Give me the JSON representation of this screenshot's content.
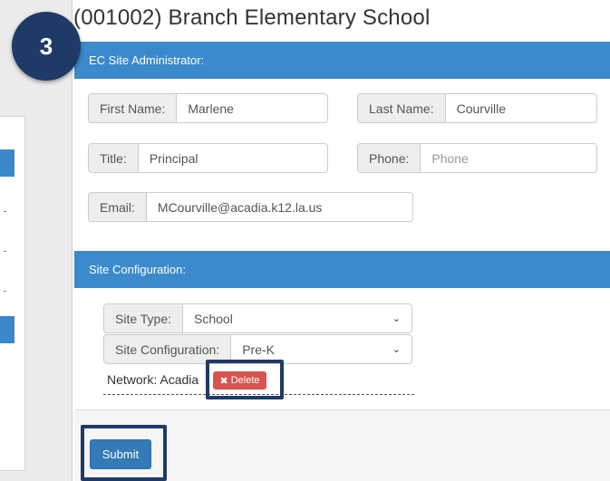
{
  "step_badge": "3",
  "page_title": "(001002) Branch Elementary School",
  "admin_section": {
    "heading": "EC Site Administrator:",
    "first_name": {
      "label": "First Name:",
      "value": "Marlene"
    },
    "last_name": {
      "label": "Last Name:",
      "value": "Courville"
    },
    "title": {
      "label": "Title:",
      "value": "Principal"
    },
    "phone": {
      "label": "Phone:",
      "value": "",
      "placeholder": "Phone"
    },
    "email": {
      "label": "Email:",
      "value": "MCourville@acadia.k12.la.us"
    }
  },
  "config_section": {
    "heading": "Site Configuration:",
    "site_type": {
      "label": "Site Type:",
      "value": "School"
    },
    "site_configuration": {
      "label": "Site Configuration:",
      "value": "Pre-K"
    },
    "network_text": "Network: Acadia",
    "delete_label": "Delete"
  },
  "submit_label": "Submit",
  "colors": {
    "accent": "#3b8acb",
    "highlight": "#1f3a66",
    "danger": "#d9534f"
  }
}
